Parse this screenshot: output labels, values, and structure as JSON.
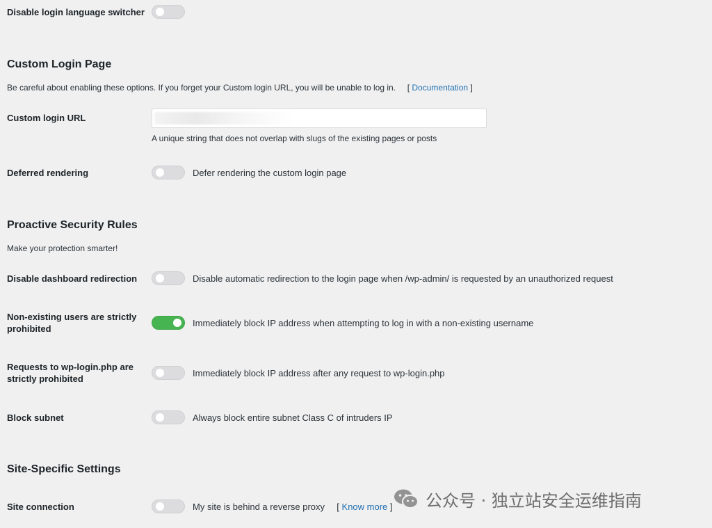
{
  "login_language": {
    "label": "Disable login language switcher",
    "enabled": false
  },
  "custom_login": {
    "title": "Custom Login Page",
    "warning": "Be careful about enabling these options. If you forget your Custom login URL, you will be unable to log in.",
    "doc_open": "[",
    "doc_link": "Documentation",
    "doc_close": "]",
    "url_label": "Custom login URL",
    "url_value": "",
    "url_help": "A unique string that does not overlap with slugs of the existing pages or posts",
    "deferred_label": "Deferred rendering",
    "deferred_desc": "Defer rendering the custom login page",
    "deferred_enabled": false
  },
  "proactive": {
    "title": "Proactive Security Rules",
    "subtitle": "Make your protection smarter!",
    "items": [
      {
        "label": "Disable dashboard redirection",
        "desc": "Disable automatic redirection to the login page when /wp-admin/ is requested by an unauthorized request",
        "enabled": false
      },
      {
        "label": "Non-existing users are strictly prohibited",
        "desc": "Immediately block IP address when attempting to log in with a non-existing username",
        "enabled": true
      },
      {
        "label": "Requests to wp-login.php are strictly prohibited",
        "desc": "Immediately block IP address after any request to wp-login.php",
        "enabled": false
      },
      {
        "label": "Block subnet",
        "desc": "Always block entire subnet Class C of intruders IP",
        "enabled": false
      }
    ]
  },
  "site_specific": {
    "title": "Site-Specific Settings",
    "connection_label": "Site connection",
    "connection_desc": "My site is behind a reverse proxy",
    "know_open": "[",
    "know_link": "Know more",
    "know_close": "]",
    "connection_enabled": false
  },
  "watermark": {
    "text": "公众号 · 独立站安全运维指南",
    "icon": "wechat-icon"
  },
  "colors": {
    "background": "#f0f0f1",
    "toggle_off": "#dcdcde",
    "toggle_on": "#46b450",
    "link": "#2271b1"
  }
}
